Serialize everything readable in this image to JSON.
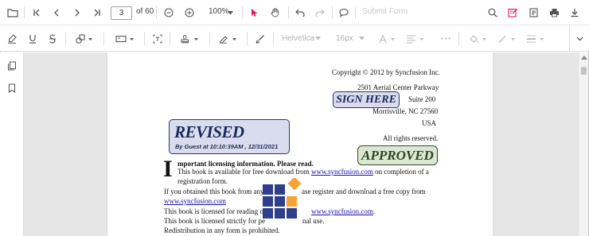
{
  "toolbar": {
    "current_page": "3",
    "page_count_label": "of 60",
    "zoom_value": "100%",
    "submit_form_label": "Submit Form"
  },
  "annotation_toolbar": {
    "font_family": "Helvetica",
    "font_size": "16px"
  },
  "document": {
    "copyright": "Copyright © 2012 by Syncfusion Inc.",
    "address_line1": "2501 Aerial Center Parkway",
    "address_line2": "Suite 200",
    "address_line3": "Morrisville, NC 27560",
    "address_line4": "USA",
    "rights": "All rights reserved.",
    "dropcap": "I",
    "heading": "mportant licensing information. Please read.",
    "para1_a": "This book is available for free download from ",
    "para1_link": "www.syncfusion.com",
    "para1_b": " on completion of a",
    "para1_c": "registration form.",
    "para2_a": "If you obtained this book from any",
    "para2_b": "ase register and download a free copy from",
    "para2_link": "www.syncfusion.com",
    "para3_a": "This book is licensed for reading o",
    "para3_link": "www.syncfusion.com",
    "para4_a": "This book is licensed strictly for pe",
    "para4_b": "nal use.",
    "para5": "Redistribution in any form is prohibited."
  },
  "stamps": {
    "revised_title": "REVISED",
    "revised_sub": "By Guest at 10:10:39AM , 12/31/2021",
    "sign_here": "SIGN HERE",
    "approved": "APPROVED"
  },
  "colors": {
    "accent": "#e3165b",
    "logo_blue": "#2f3f8c",
    "logo_orange": "#f7a234"
  }
}
